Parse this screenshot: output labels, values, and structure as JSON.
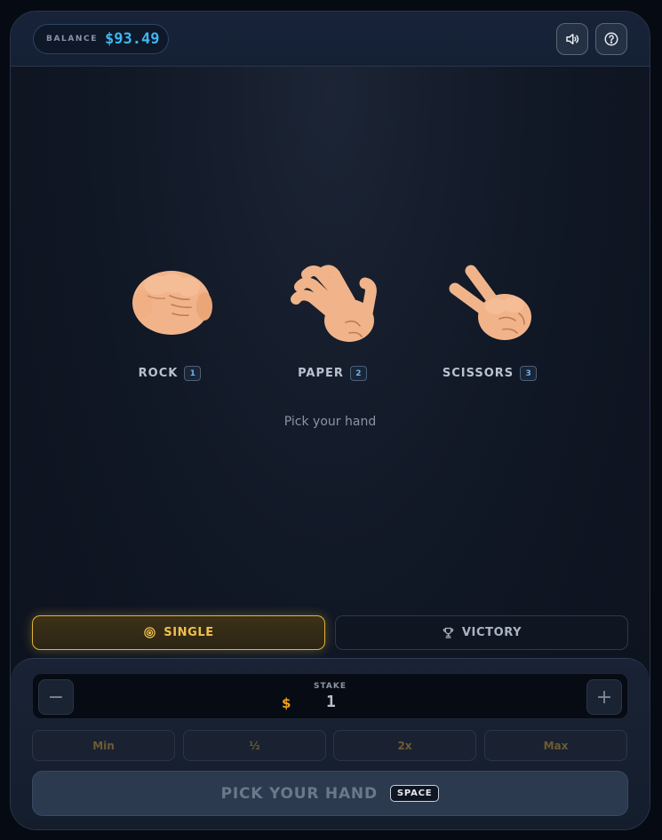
{
  "header": {
    "balance_label": "BALANCE",
    "balance_value": "$93.49",
    "sound_icon": "speaker-icon",
    "help_icon": "help-icon"
  },
  "hands": [
    {
      "label": "ROCK",
      "key": "1",
      "icon": "fist-icon"
    },
    {
      "label": "PAPER",
      "key": "2",
      "icon": "open-hand-icon"
    },
    {
      "label": "SCISSORS",
      "key": "3",
      "icon": "victory-hand-icon"
    }
  ],
  "hint": "Pick your hand",
  "modes": {
    "single": {
      "label": "SINGLE",
      "icon": "target-icon",
      "active": true
    },
    "victory": {
      "label": "VICTORY",
      "icon": "trophy-icon",
      "active": false
    }
  },
  "stake": {
    "label": "STAKE",
    "currency": "$",
    "value": "1",
    "decrease": "−",
    "increase": "+"
  },
  "quick_bets": [
    "Min",
    "½",
    "2x",
    "Max"
  ],
  "action": {
    "label": "PICK YOUR HAND",
    "key": "SPACE"
  },
  "colors": {
    "accent_gold": "#f0c04c",
    "balance_blue": "#3fb6f5",
    "stake_currency": "#f2a21c"
  }
}
